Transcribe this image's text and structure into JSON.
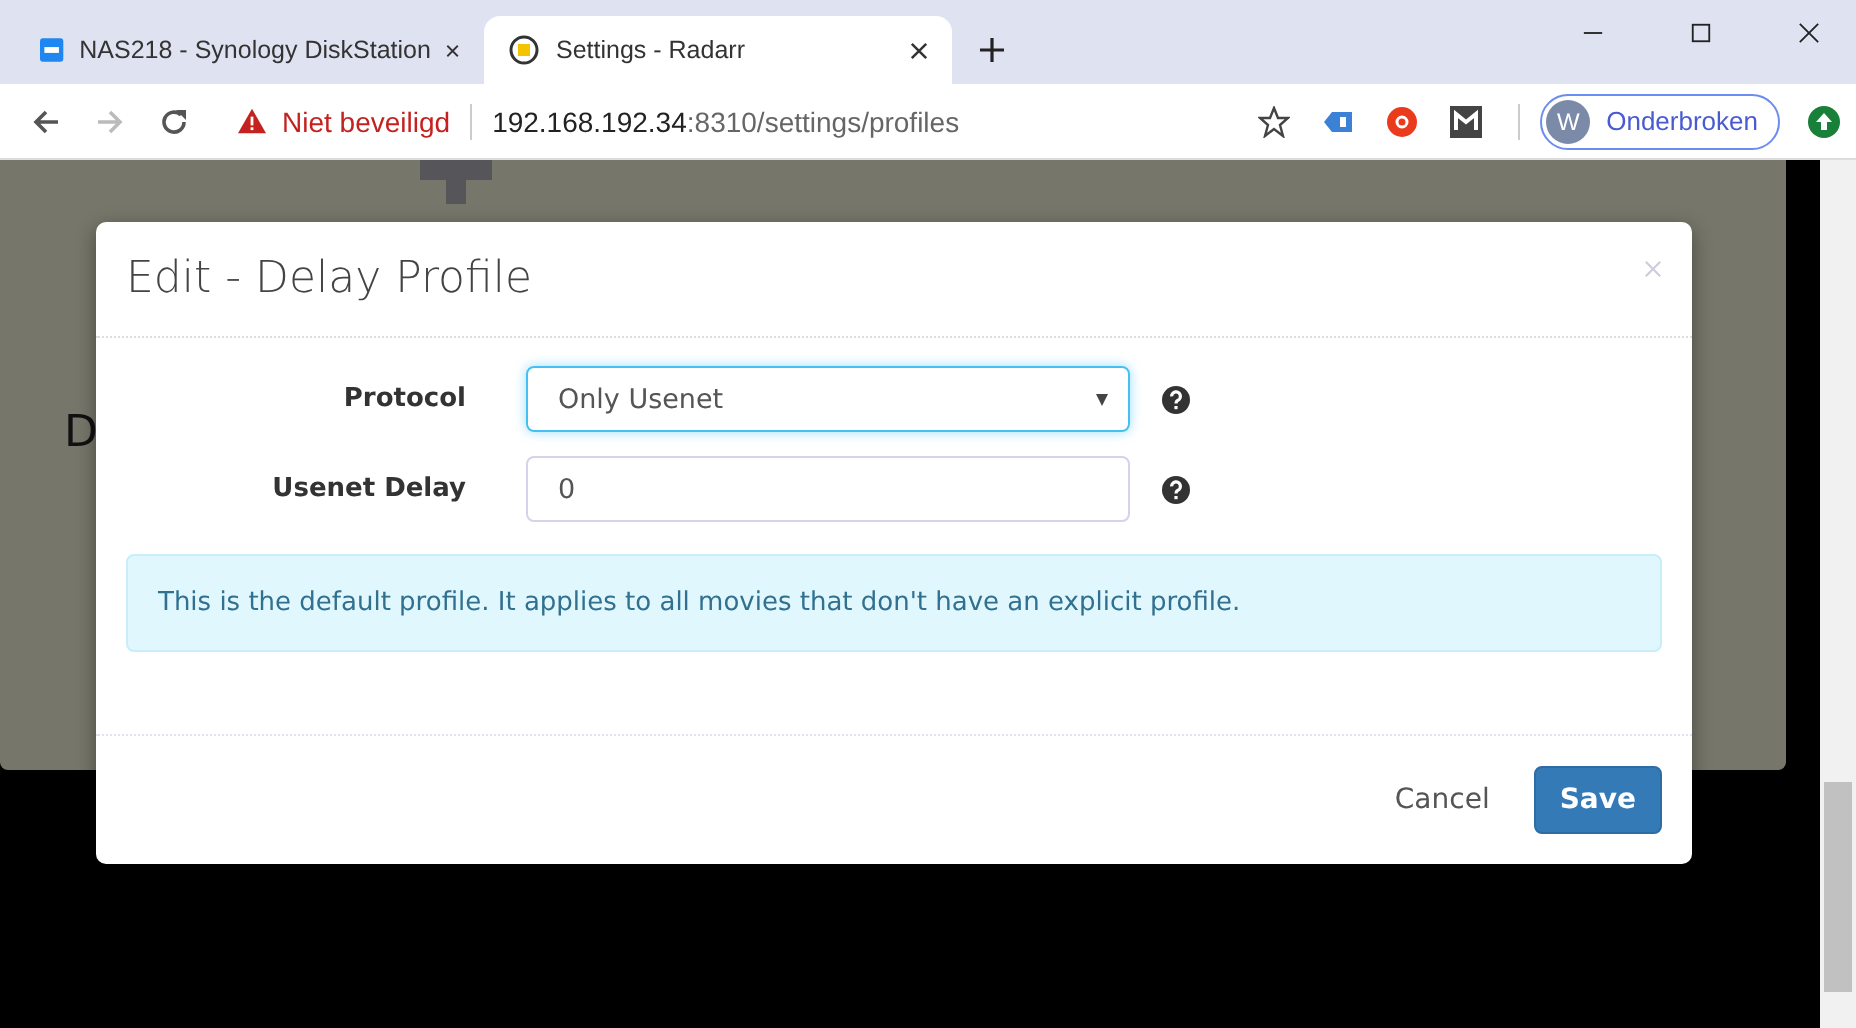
{
  "browser": {
    "tabs": [
      {
        "title": "NAS218 - Synology DiskStation",
        "kind": "dsm",
        "selected": false
      },
      {
        "title": "Settings - Radarr",
        "kind": "radarr",
        "selected": true
      }
    ],
    "address": {
      "security": "Niet beveiligd",
      "host": "192.168.192.34",
      "rest": ":8310/settings/profiles"
    },
    "profile": {
      "initial": "W",
      "status": "Onderbroken"
    }
  },
  "page_behind": {
    "heading_fragment": "D"
  },
  "modal": {
    "title": "Edit - Delay Profile",
    "fields": [
      {
        "kind": "select",
        "label": "Protocol",
        "value": "Only Usenet",
        "focused": true
      },
      {
        "kind": "input",
        "label": "Usenet Delay",
        "value": "0",
        "focused": false
      }
    ],
    "info": "This is the default profile. It applies to all movies that don't have an explicit profile.",
    "buttons": [
      {
        "kind": "link",
        "label": "Cancel"
      },
      {
        "kind": "primary",
        "label": "Save"
      }
    ]
  }
}
